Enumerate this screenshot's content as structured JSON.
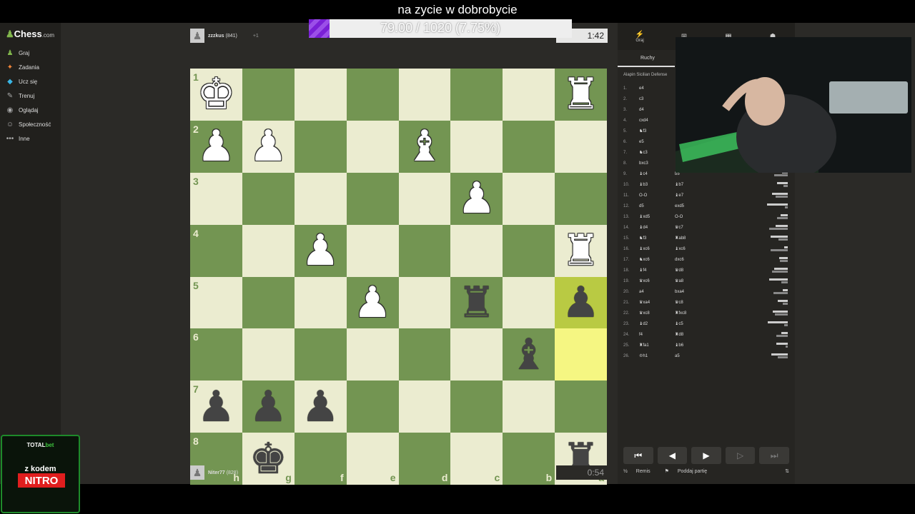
{
  "stream": {
    "title": "na zycie w dobrobycie",
    "progress_text": "79.00 / 1020 (7.75%)",
    "progress_fraction": 0.0775
  },
  "sidebar": {
    "logo": "Chess",
    "logo_suffix": ".com",
    "items": [
      {
        "label": "Graj",
        "icon": "play-icon",
        "color": "#81b64c"
      },
      {
        "label": "Zadania",
        "icon": "puzzle-icon",
        "color": "#f5873a"
      },
      {
        "label": "Ucz się",
        "icon": "learn-icon",
        "color": "#3ab6e5"
      },
      {
        "label": "Trenuj",
        "icon": "train-icon",
        "color": "#aaaaaa"
      },
      {
        "label": "Oglądaj",
        "icon": "watch-icon",
        "color": "#aaaaaa"
      },
      {
        "label": "Społeczność",
        "icon": "community-icon",
        "color": "#aaaaaa"
      },
      {
        "label": "Inne",
        "icon": "more-icon",
        "color": "#aaaaaa"
      }
    ]
  },
  "top_player": {
    "name": "zzzkus",
    "rating": "(841)",
    "captured": "+1",
    "clock": "1:42"
  },
  "bottom_player": {
    "name": "Niter77",
    "rating": "(828)",
    "clock": "0:54"
  },
  "board": {
    "ranks": [
      "1",
      "2",
      "3",
      "4",
      "5",
      "6",
      "7",
      "8"
    ],
    "files": [
      "h",
      "g",
      "f",
      "e",
      "d",
      "c",
      "b",
      "a"
    ],
    "squares": [
      [
        "wK",
        "",
        "",
        "",
        "",
        "",
        "",
        "wR"
      ],
      [
        "wP",
        "wP",
        "",
        "",
        "wB",
        "",
        "",
        ""
      ],
      [
        "",
        "",
        "",
        "",
        "",
        "wP",
        "",
        ""
      ],
      [
        "",
        "",
        "wP",
        "",
        "",
        "",
        "",
        "wR"
      ],
      [
        "",
        "",
        "",
        "wP",
        "",
        "bR",
        "",
        "bP"
      ],
      [
        "",
        "",
        "",
        "",
        "",
        "",
        "bB",
        ""
      ],
      [
        "bP",
        "bP",
        "bP",
        "",
        "",
        "",
        "",
        ""
      ],
      [
        "",
        "bK",
        "",
        "",
        "",
        "",
        "",
        "bR"
      ]
    ],
    "highlight": [
      "4-7",
      "5-7"
    ]
  },
  "panel": {
    "tabs": [
      "Graj",
      "",
      "",
      ""
    ],
    "subtab": "Ruchy",
    "opening": "Alapin Sicilian Defense",
    "moves": [
      {
        "n": "1.",
        "w": "e4",
        "b": ""
      },
      {
        "n": "2.",
        "w": "c3",
        "b": ""
      },
      {
        "n": "3.",
        "w": "d4",
        "b": ""
      },
      {
        "n": "4.",
        "w": "cxd4",
        "b": ""
      },
      {
        "n": "5.",
        "w": "♞f3",
        "b": ""
      },
      {
        "n": "6.",
        "w": "e5",
        "b": ""
      },
      {
        "n": "7.",
        "w": "♞c3",
        "b": ""
      },
      {
        "n": "8.",
        "w": "bxc3",
        "b": ""
      },
      {
        "n": "9.",
        "w": "♝c4",
        "b": "b5"
      },
      {
        "n": "10.",
        "w": "♝b3",
        "b": "♝b7"
      },
      {
        "n": "11.",
        "w": "O-O",
        "b": "♝e7"
      },
      {
        "n": "12.",
        "w": "d5",
        "b": "exd5"
      },
      {
        "n": "13.",
        "w": "♝xd5",
        "b": "O-O"
      },
      {
        "n": "14.",
        "w": "♝d4",
        "b": "♛c7"
      },
      {
        "n": "15.",
        "w": "♞f3",
        "b": "♜ab8"
      },
      {
        "n": "16.",
        "w": "♝xc6",
        "b": "♝xc6"
      },
      {
        "n": "17.",
        "w": "♞xc6",
        "b": "dxc6"
      },
      {
        "n": "18.",
        "w": "♝f4",
        "b": "♛d8"
      },
      {
        "n": "19.",
        "w": "♛xc6",
        "b": "♛a8"
      },
      {
        "n": "20.",
        "w": "a4",
        "b": "bxa4"
      },
      {
        "n": "21.",
        "w": "♛xa4",
        "b": "♛c8"
      },
      {
        "n": "22.",
        "w": "♛xc8",
        "b": "♜fxc8"
      },
      {
        "n": "23.",
        "w": "♝d2",
        "b": "♝c5"
      },
      {
        "n": "24.",
        "w": "f4",
        "b": "♜d8"
      },
      {
        "n": "25.",
        "w": "♜fa1",
        "b": "♝b6"
      },
      {
        "n": "26.",
        "w": "♔h1",
        "b": "a5"
      }
    ],
    "draw_label": "Remis",
    "resign_label": "Poddaj partię",
    "draw_icon": "½"
  },
  "ad": {
    "brand_a": "TOTAL",
    "brand_b": "bet",
    "line1": "z kodem",
    "line2": "NITRO"
  }
}
